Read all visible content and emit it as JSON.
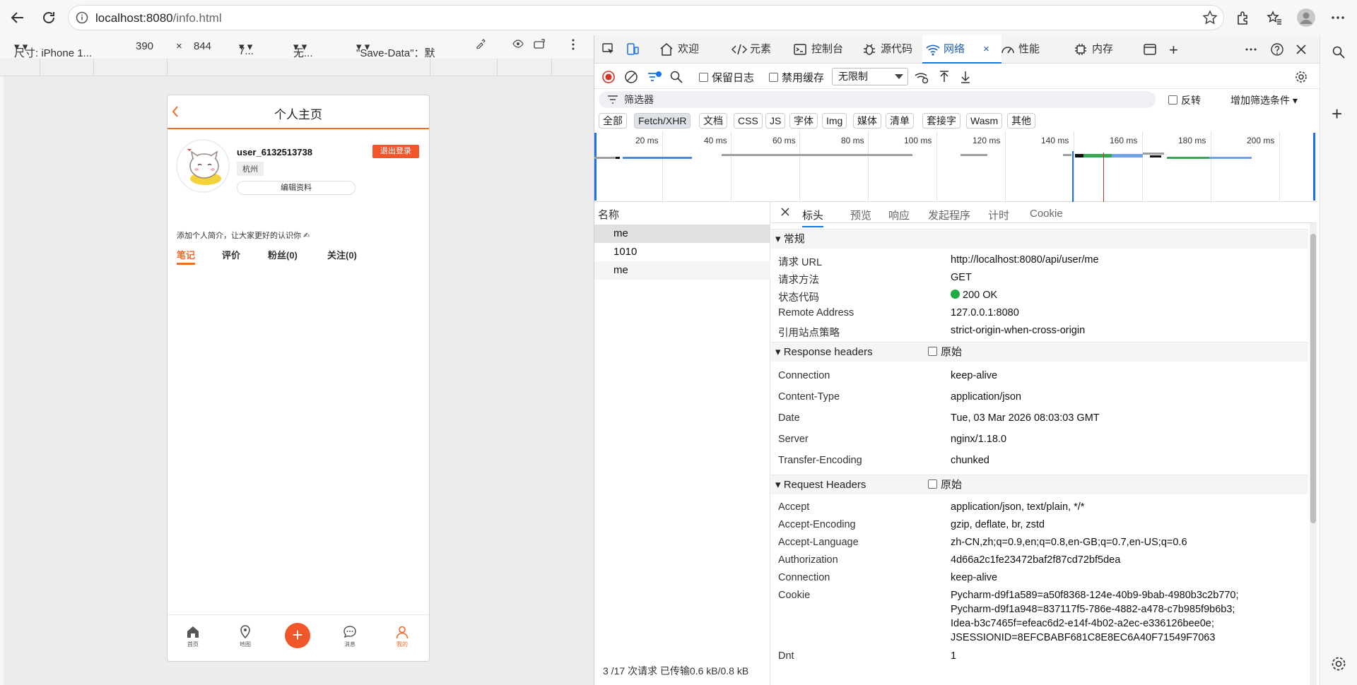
{
  "browser": {
    "url_host": "localhost:8080",
    "url_path": "/info.html"
  },
  "device_bar": {
    "device": "尺寸: iPhone 1...",
    "width": "390",
    "times": "×",
    "height": "844",
    "zoom": "7...",
    "throttle": "无...",
    "save_data": "\"Save-Data\"：默"
  },
  "phone": {
    "title": "个人主页",
    "username": "user_6132513738",
    "city": "杭州",
    "edit_profile": "编辑资料",
    "logout": "退出登录",
    "intro": "添加个人简介，让大家更好的认识你 ✍",
    "tabs": [
      "笔记",
      "评价",
      "粉丝(0)",
      "关注(0)"
    ],
    "nav": [
      "首页",
      "地图",
      "消息",
      "我的"
    ]
  },
  "devtools": {
    "tabs": [
      "欢迎",
      "元素",
      "控制台",
      "源代码",
      "网络",
      "性能",
      "内存"
    ],
    "toolbar": {
      "preserve_log": "保留日志",
      "disable_cache": "禁用缓存",
      "throttle": "无限制"
    },
    "filter_placeholder": "筛选器",
    "invert": "反转",
    "more_filters": "增加筛选条件",
    "types": [
      "全部",
      "Fetch/XHR",
      "文档",
      "CSS",
      "JS",
      "字体",
      "Img",
      "媒体",
      "清单",
      "套接字",
      "Wasm",
      "其他"
    ],
    "timeline_labels": [
      "20 ms",
      "40 ms",
      "60 ms",
      "80 ms",
      "100 ms",
      "120 ms",
      "140 ms",
      "160 ms",
      "180 ms",
      "200 ms"
    ],
    "name_header": "名称",
    "requests": [
      "me",
      "1010",
      "me"
    ],
    "summary": "3 /17 次请求   已传输0.6 kB/0.8 kB",
    "detail_tabs": [
      "标头",
      "预览",
      "响应",
      "发起程序",
      "计时",
      "Cookie"
    ],
    "general": {
      "title": "▾ 常规",
      "rows": [
        {
          "k": "请求 URL",
          "v": "http://localhost:8080/api/user/me"
        },
        {
          "k": "请求方法",
          "v": "GET"
        },
        {
          "k": "状态代码",
          "v": "200 OK"
        },
        {
          "k": "Remote Address",
          "v": "127.0.0.1:8080"
        },
        {
          "k": "引用站点策略",
          "v": "strict-origin-when-cross-origin"
        }
      ]
    },
    "response_headers": {
      "title": "▾ Response headers",
      "raw": "原始",
      "rows": [
        {
          "k": "Connection",
          "v": "keep-alive"
        },
        {
          "k": "Content-Type",
          "v": "application/json"
        },
        {
          "k": "Date",
          "v": "Tue, 03 Mar 2026 08:03:03 GMT"
        },
        {
          "k": "Server",
          "v": "nginx/1.18.0"
        },
        {
          "k": "Transfer-Encoding",
          "v": "chunked"
        }
      ]
    },
    "request_headers": {
      "title": "▾ Request Headers",
      "raw": "原始",
      "rows": [
        {
          "k": "Accept",
          "v": "application/json, text/plain, */*"
        },
        {
          "k": "Accept-Encoding",
          "v": "gzip, deflate, br, zstd"
        },
        {
          "k": "Accept-Language",
          "v": "zh-CN,zh;q=0.9,en;q=0.8,en-GB;q=0.7,en-US;q=0.6"
        },
        {
          "k": "Authorization",
          "v": "4d66a2c1fe23472baf2f87cd72bf5dea"
        },
        {
          "k": "Connection",
          "v": "keep-alive"
        },
        {
          "k": "Cookie",
          "v": "Pycharm-d9f1a589=a50f8368-124e-40b9-9bab-4980b3c2b770;"
        },
        {
          "k": "",
          "v": "Pycharm-d9f1a948=837117f5-786e-4882-a478-c7b985f9b6b3;"
        },
        {
          "k": "",
          "v": "Idea-b3c7465f=efeac6d2-e14f-4b02-a2ec-e336126bee0e;"
        },
        {
          "k": "",
          "v": "JSESSIONID=8EFCBABF681C8E8EC6A40F71549F7063"
        },
        {
          "k": "Dnt",
          "v": "1"
        }
      ]
    }
  }
}
